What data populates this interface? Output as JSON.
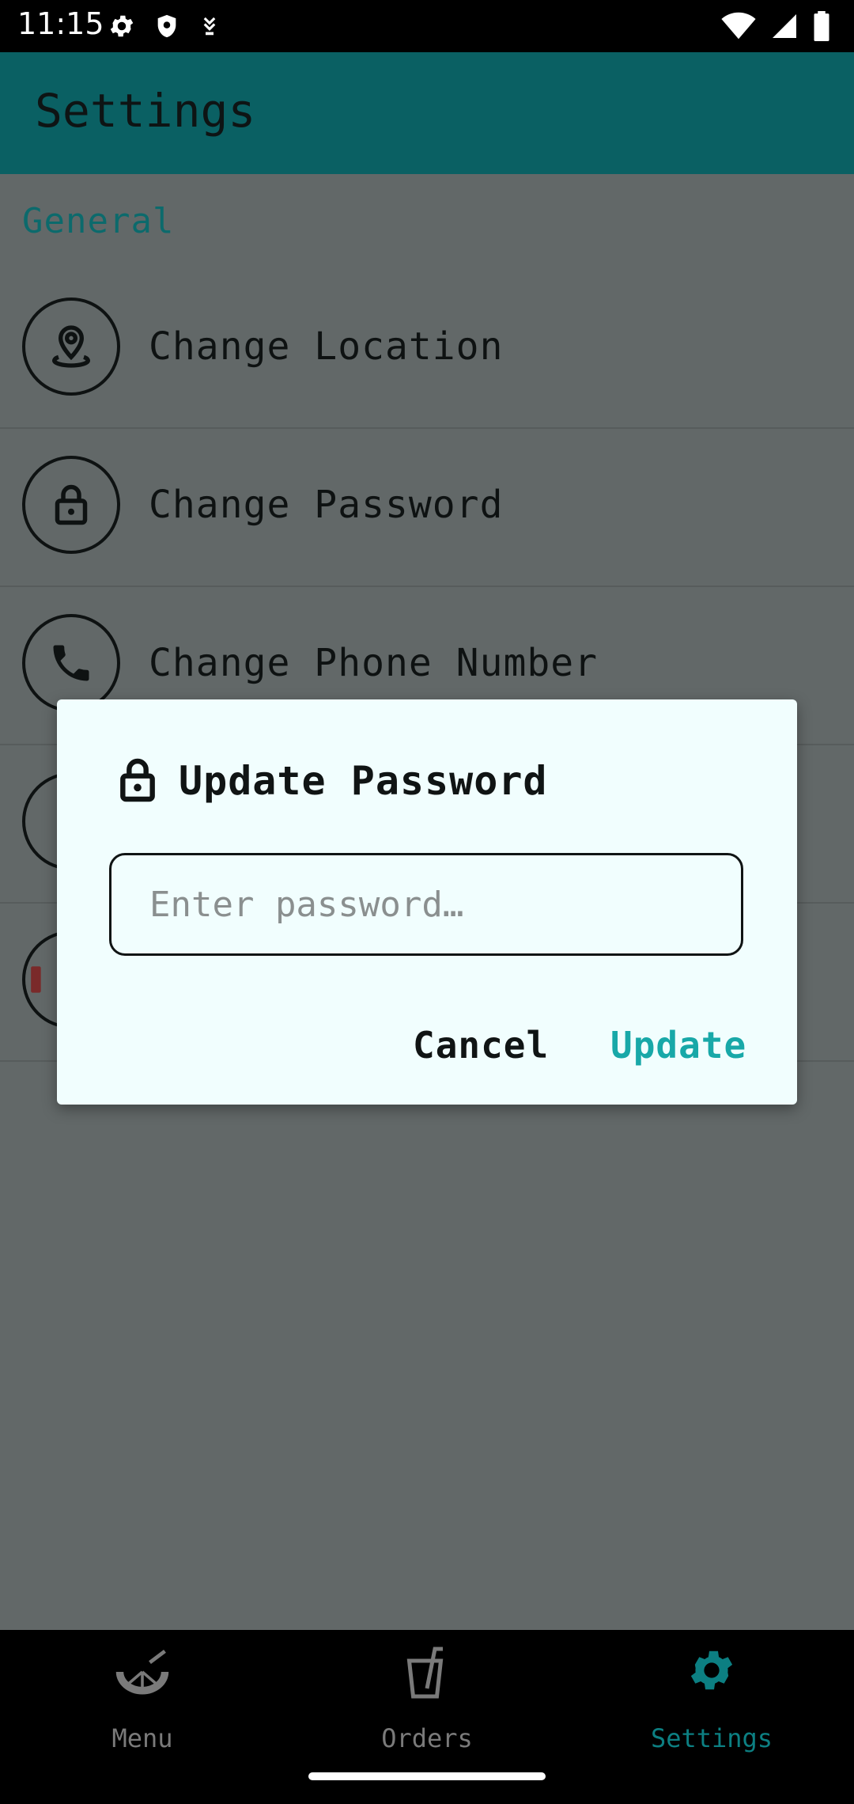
{
  "status_bar": {
    "time": "11:15",
    "left_icons": [
      "gear-icon",
      "shield-icon",
      "download-icon"
    ],
    "right_icons": [
      "wifi-icon",
      "signal-icon",
      "battery-icon"
    ]
  },
  "app_bar": {
    "title": "Settings"
  },
  "settings": {
    "section_title": "General",
    "items": [
      {
        "label": "Change Location",
        "icon": "location-pin-icon"
      },
      {
        "label": "Change Password",
        "icon": "lock-icon"
      },
      {
        "label": "Change Phone Number",
        "icon": "phone-icon"
      }
    ]
  },
  "dialog": {
    "icon": "lock-icon",
    "title": "Update Password",
    "input_placeholder": "Enter password…",
    "input_value": "",
    "cancel_label": "Cancel",
    "update_label": "Update"
  },
  "bottom_nav": {
    "items": [
      {
        "label": "Menu",
        "icon": "lemon-slice-icon",
        "active": false
      },
      {
        "label": "Orders",
        "icon": "drink-cup-icon",
        "active": false
      },
      {
        "label": "Settings",
        "icon": "gear-icon",
        "active": true
      }
    ]
  },
  "colors": {
    "app_bar": "#0a6063",
    "accent": "#18a8a8",
    "dialog_bg": "#f1fefe",
    "scrim_bg": "#626868"
  }
}
